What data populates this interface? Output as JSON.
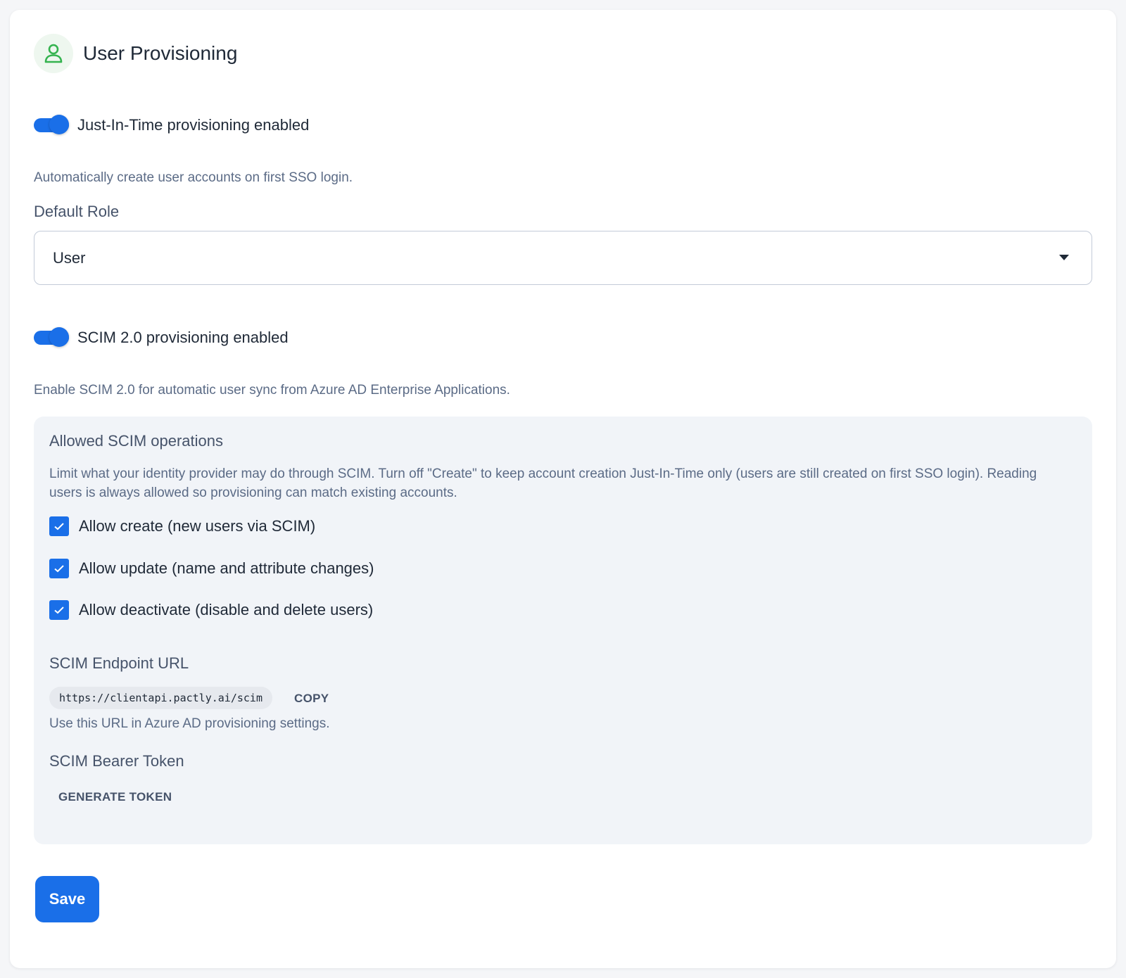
{
  "header": {
    "title": "User Provisioning",
    "icon": "user-icon"
  },
  "jit": {
    "label": "Just-In-Time provisioning enabled",
    "enabled": true,
    "helper": "Automatically create user accounts on first SSO login."
  },
  "default_role": {
    "label": "Default Role",
    "value": "User"
  },
  "scim": {
    "label": "SCIM 2.0 provisioning enabled",
    "enabled": true,
    "helper": "Enable SCIM 2.0 for automatic user sync from Azure AD Enterprise Applications."
  },
  "operations": {
    "title": "Allowed SCIM operations",
    "description": "Limit what your identity provider may do through SCIM. Turn off \"Create\" to keep account creation Just-In-Time only (users are still created on first SSO login). Reading users is always allowed so provisioning can match existing accounts.",
    "items": [
      {
        "label": "Allow create (new users via SCIM)",
        "checked": true
      },
      {
        "label": "Allow update (name and attribute changes)",
        "checked": true
      },
      {
        "label": "Allow deactivate (disable and delete users)",
        "checked": true
      }
    ]
  },
  "endpoint": {
    "title": "SCIM Endpoint URL",
    "url": "https://clientapi.pactly.ai/scim",
    "copy_label": "COPY",
    "helper": "Use this URL in Azure AD provisioning settings."
  },
  "token": {
    "title": "SCIM Bearer Token",
    "generate_label": "GENERATE TOKEN"
  },
  "actions": {
    "save_label": "Save"
  },
  "colors": {
    "accent": "#1a6fe8",
    "icon_green": "#34b34f",
    "panel_bg": "#f1f4f8"
  }
}
